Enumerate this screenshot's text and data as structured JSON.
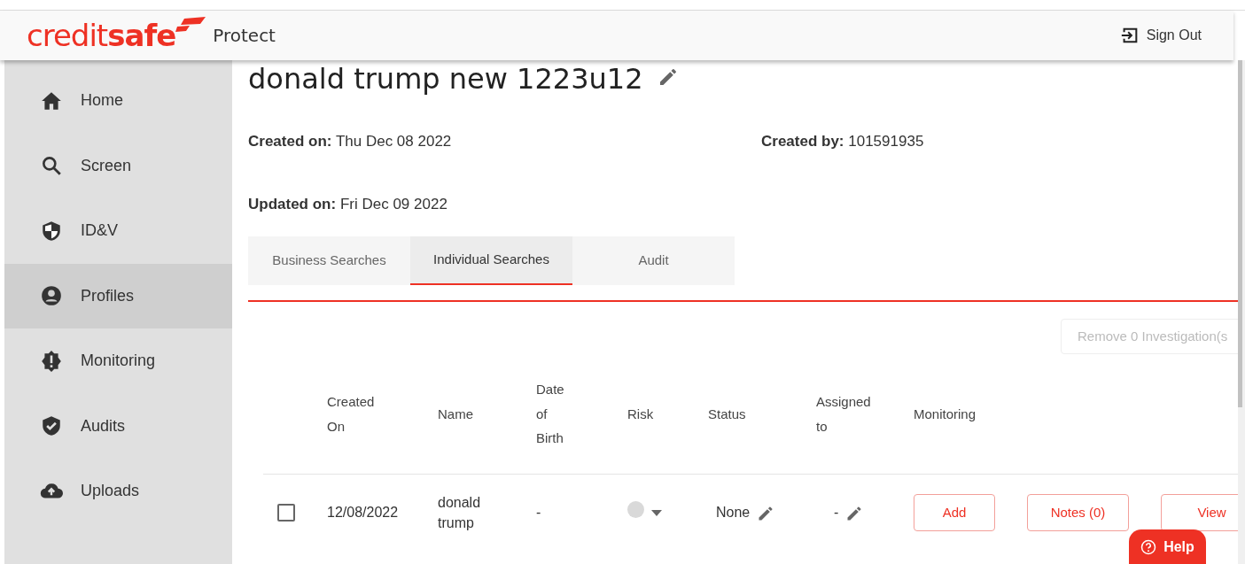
{
  "header": {
    "logo": "credit**safe**",
    "product": "Protect",
    "sign_out": "Sign Out"
  },
  "sidebar": {
    "items": [
      {
        "label": "Home",
        "kind": "home",
        "selected": false
      },
      {
        "label": "Screen",
        "kind": "search",
        "selected": false
      },
      {
        "label": "ID&V",
        "kind": "shield",
        "selected": false
      },
      {
        "label": "Profiles",
        "kind": "user",
        "selected": true
      },
      {
        "label": "Monitoring",
        "kind": "alert",
        "selected": false
      },
      {
        "label": "Audits",
        "kind": "check",
        "selected": false
      },
      {
        "label": "Uploads",
        "kind": "upload",
        "selected": false
      }
    ]
  },
  "profile": {
    "title": "donald trump new 1223u12",
    "meta": [
      {
        "text": "**Created on:** Thu Dec 08 2022"
      },
      {
        "text": "**Created by:** 101591935"
      },
      {
        "text": "**Updated on:** Fri Dec 09 2022"
      }
    ]
  },
  "tabs": [
    {
      "label": "Business Searches",
      "selected": false
    },
    {
      "label": "Individual Searches",
      "selected": true
    },
    {
      "label": "Audit",
      "selected": false
    }
  ],
  "remove_button": {
    "label": "Remove 0 Investigation(s",
    "disabled": true
  },
  "table": {
    "columns": [
      "Created On",
      "Name",
      "Date of Birth",
      "Risk",
      "Status",
      "Assigned to",
      "Monitoring"
    ],
    "rows": [
      {
        "checked": false,
        "created_on": "12/08/2022",
        "name": "donald trump",
        "date_of_birth": "-",
        "color": "#d9d9d9",
        "status": "None",
        "assigned_to": "-",
        "actions": [
          "Add",
          "Notes (0)",
          "View"
        ]
      }
    ]
  },
  "help": "Help"
}
